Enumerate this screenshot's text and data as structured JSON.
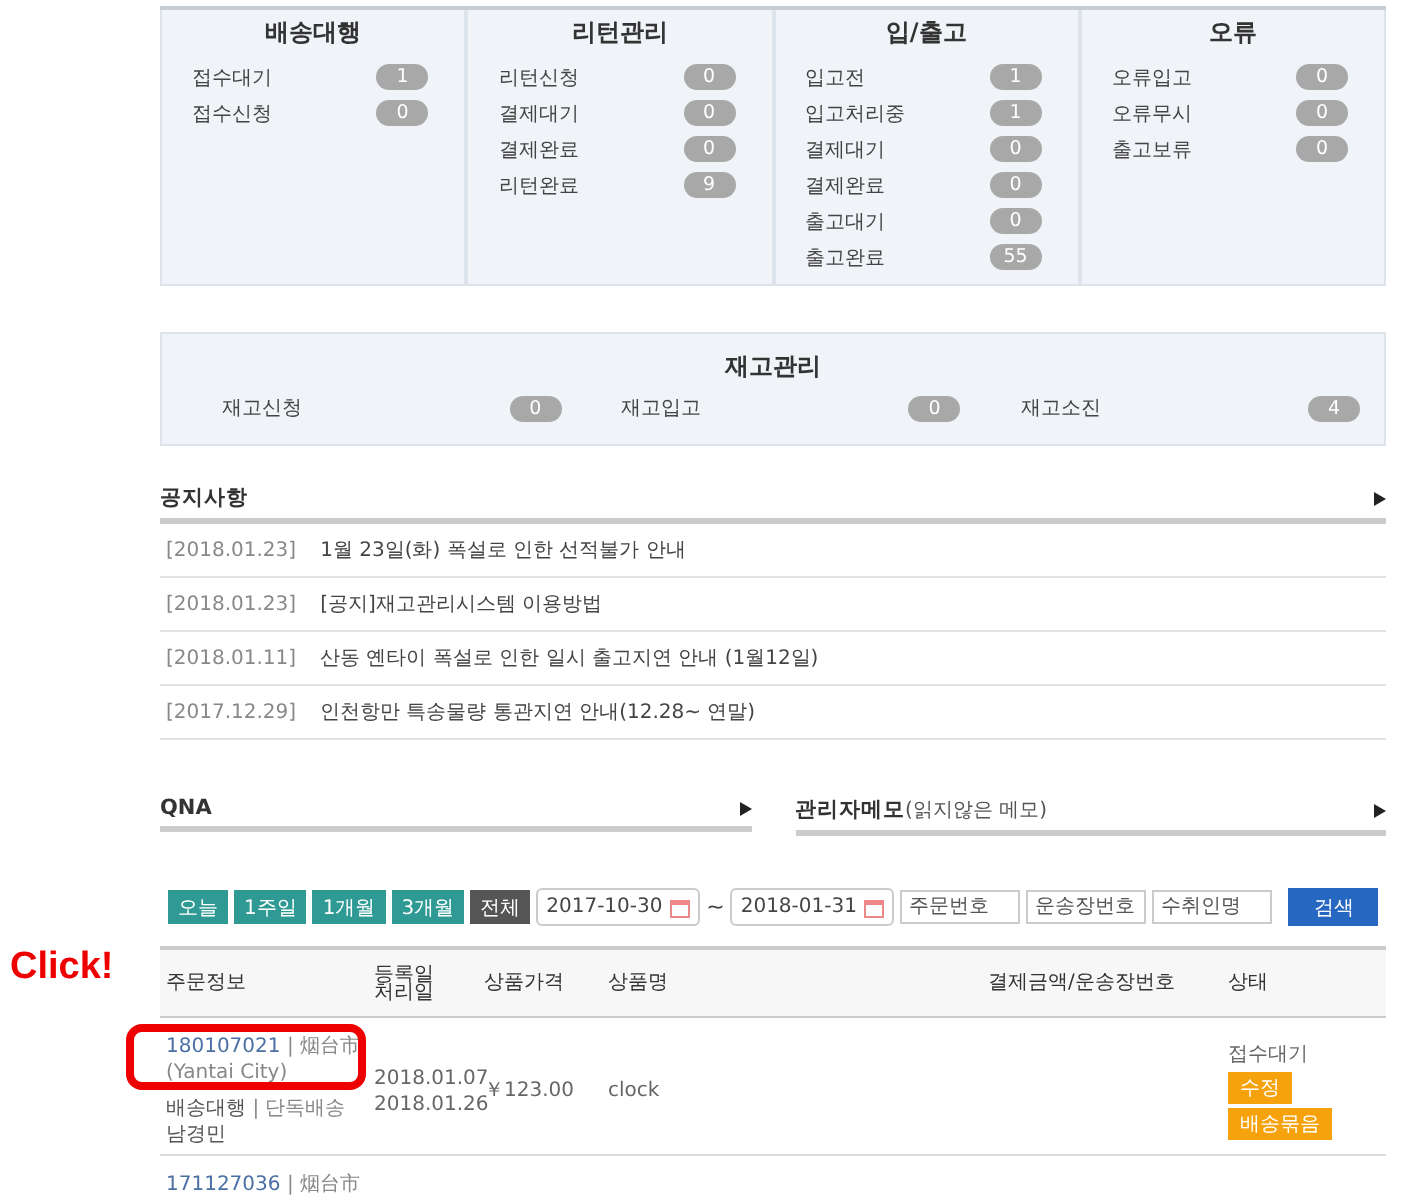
{
  "summary_panels": [
    {
      "title": "배송대행",
      "items": [
        {
          "label": "접수대기",
          "count": "1"
        },
        {
          "label": "접수신청",
          "count": "0"
        }
      ]
    },
    {
      "title": "리턴관리",
      "items": [
        {
          "label": "리턴신청",
          "count": "0"
        },
        {
          "label": "결제대기",
          "count": "0"
        },
        {
          "label": "결제완료",
          "count": "0"
        },
        {
          "label": "리턴완료",
          "count": "9"
        }
      ]
    },
    {
      "title": "입/출고",
      "items": [
        {
          "label": "입고전",
          "count": "1"
        },
        {
          "label": "입고처리중",
          "count": "1"
        },
        {
          "label": "결제대기",
          "count": "0"
        },
        {
          "label": "결제완료",
          "count": "0"
        },
        {
          "label": "출고대기",
          "count": "0"
        },
        {
          "label": "출고완료",
          "count": "55"
        }
      ]
    },
    {
      "title": "오류",
      "items": [
        {
          "label": "오류입고",
          "count": "0"
        },
        {
          "label": "오류무시",
          "count": "0"
        },
        {
          "label": "출고보류",
          "count": "0"
        }
      ]
    }
  ],
  "inventory": {
    "title": "재고관리",
    "items": [
      {
        "label": "재고신청",
        "count": "0"
      },
      {
        "label": "재고입고",
        "count": "0"
      },
      {
        "label": "재고소진",
        "count": "4"
      }
    ]
  },
  "notices": {
    "title": "공지사항",
    "items": [
      {
        "date": "[2018.01.23]",
        "text": "1월 23일(화) 폭설로 인한 선적불가 안내"
      },
      {
        "date": "[2018.01.23]",
        "text": "[공지]재고관리시스템 이용방법"
      },
      {
        "date": "[2018.01.11]",
        "text": "산동 옌타이 폭설로 인한 일시 출고지연 안내 (1월12일)"
      },
      {
        "date": "[2017.12.29]",
        "text": "인천항만 특송물량 통관지연 안내(12.28~ 연말)"
      }
    ]
  },
  "qna": {
    "title": "QNA"
  },
  "memo": {
    "title": "관리자메모",
    "note": "(읽지않은 메모)"
  },
  "filters": {
    "periods": [
      {
        "label": "오늘",
        "selected": false
      },
      {
        "label": "1주일",
        "selected": false
      },
      {
        "label": "1개월",
        "selected": false
      },
      {
        "label": "3개월",
        "selected": false
      },
      {
        "label": "전체",
        "selected": true
      }
    ],
    "date_from": "2017-10-30",
    "separator": "~",
    "date_to": "2018-01-31",
    "fields": [
      {
        "placeholder": "주문번호"
      },
      {
        "placeholder": "운송장번호"
      },
      {
        "placeholder": "수취인명"
      }
    ],
    "search_button": "검색"
  },
  "table": {
    "columns": [
      {
        "lines": [
          "주문정보"
        ]
      },
      {
        "lines": [
          "등록일",
          "처리일"
        ]
      },
      {
        "lines": [
          "상품가격"
        ]
      },
      {
        "lines": [
          "상품명"
        ]
      },
      {
        "lines": [
          "결제금액/운송장번호"
        ]
      },
      {
        "lines": [
          "상태"
        ]
      }
    ],
    "rows": [
      {
        "order_no": "180107021",
        "region": "| 烟台市",
        "region_en": "(Yantai City)",
        "service": "배송대행",
        "shipping": "| 단독배송",
        "recipient": "남경민",
        "registered": "2018.01.07",
        "processed": "2018.01.26",
        "price": "￥123.00",
        "product": "clock",
        "status": "접수대기",
        "actions": [
          "수정",
          "배송묶음"
        ]
      },
      {
        "order_no": "171127036",
        "region": "| 烟台市"
      }
    ]
  },
  "callout": {
    "text": "Click!"
  }
}
